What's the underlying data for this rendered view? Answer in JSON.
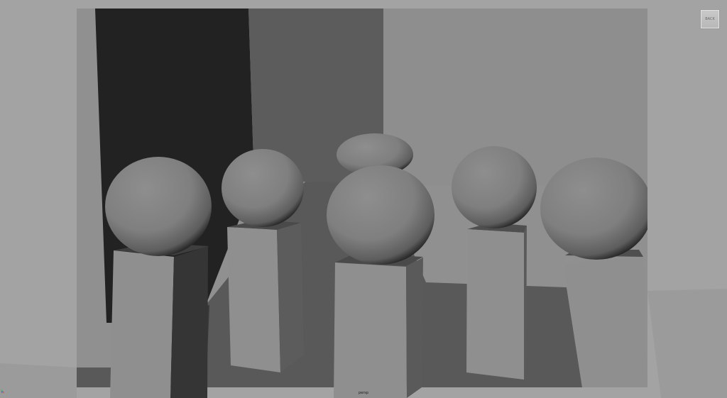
{
  "viewcube": {
    "label": "BACK"
  },
  "viewport": {
    "camera": "persp"
  },
  "colors": {
    "background": "#a3a3a3",
    "wall_dark": "#222222",
    "wall_mid": "#5c5c5c",
    "floor": "#595959",
    "resolution_gate": "#909090"
  }
}
